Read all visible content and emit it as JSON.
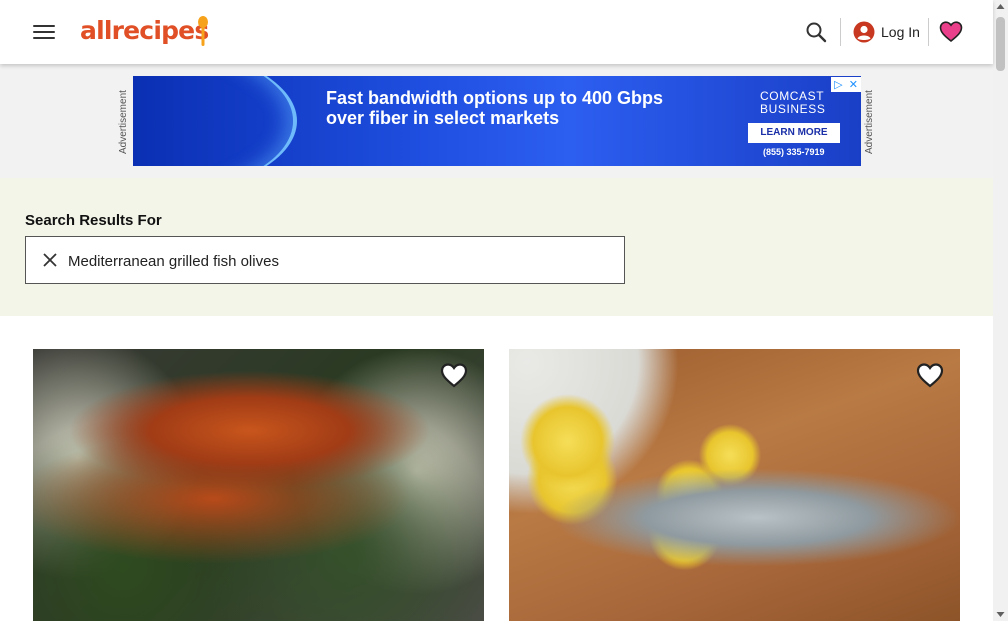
{
  "header": {
    "logo_text": "allrecipes",
    "login_label": "Log In",
    "brand_color": "#e04f25"
  },
  "icons": {
    "menu": "hamburger-menu-icon",
    "search": "search-icon",
    "account": "account-circle-icon",
    "favorites": "heart-icon",
    "clear": "close-icon",
    "save": "heart-outline-icon"
  },
  "ad": {
    "label": "Advertisement",
    "headline_line1": "Fast bandwidth options up to 400 Gbps",
    "headline_line2": "over fiber in select markets",
    "brand_line1": "COMCAST",
    "brand_line2": "BUSINESS",
    "cta": "LEARN MORE",
    "phone": "(855) 335-7919"
  },
  "search": {
    "title": "Search Results For",
    "query": "Mediterranean grilled fish olives"
  },
  "results": [
    {
      "image_desc": "grilled fish fillet with spinach and artichoke"
    },
    {
      "image_desc": "whole grilled fish with lemon slices and rosemary"
    }
  ],
  "colors": {
    "search_bg": "#f4f5e9",
    "ad_bg": "#1f4fe0",
    "favorites_heart": "#ea3f8a"
  }
}
